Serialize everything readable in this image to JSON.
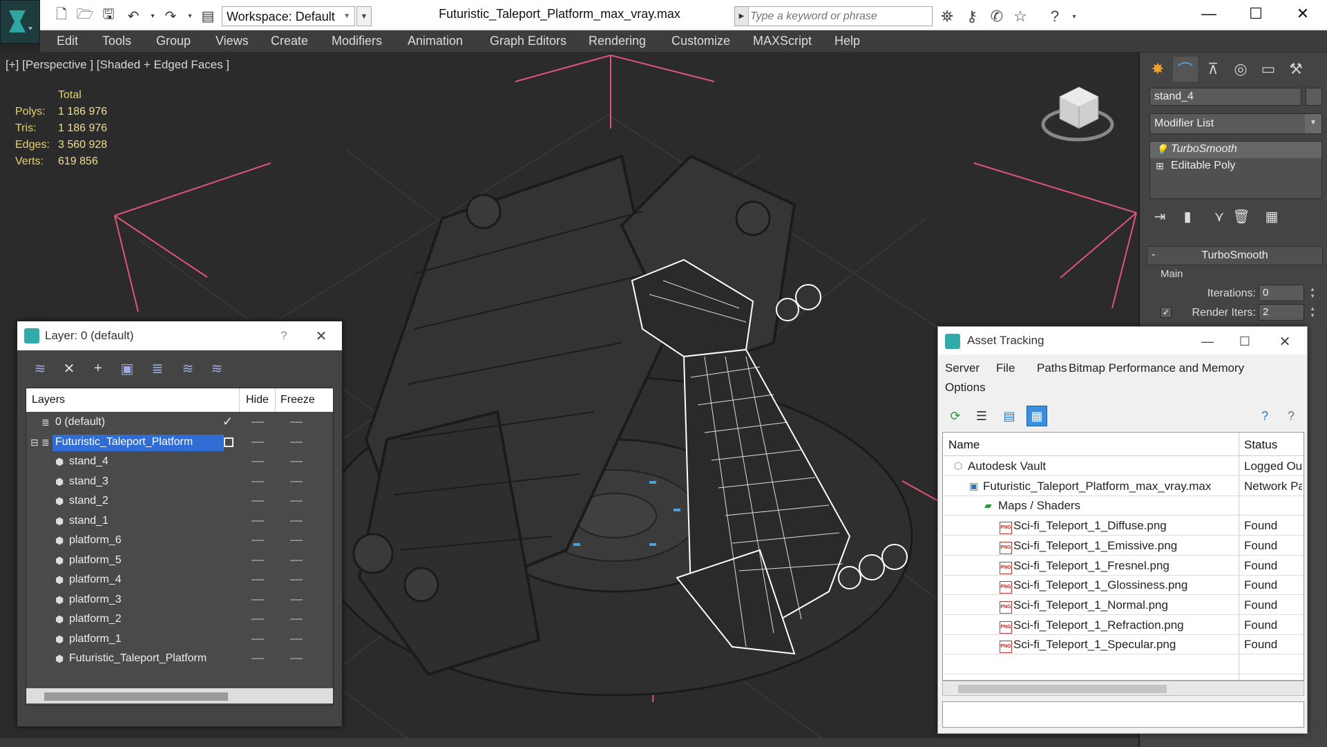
{
  "titlebar": {
    "workspace": "Workspace: Default",
    "document_title": "Futuristic_Taleport_Platform_max_vray.max",
    "search_placeholder": "Type a keyword or phrase"
  },
  "menubar": {
    "items": [
      "Edit",
      "Tools",
      "Group",
      "Views",
      "Create",
      "Modifiers",
      "Animation",
      "Graph Editors",
      "Rendering",
      "Customize",
      "MAXScript",
      "Help"
    ]
  },
  "viewport": {
    "label": "[+] [Perspective ] [Shaded + Edged Faces ]",
    "stats": {
      "header": "Total",
      "polys_label": "Polys:",
      "polys": "1 186 976",
      "tris_label": "Tris:",
      "tris": "1 186 976",
      "edges_label": "Edges:",
      "edges": "3 560 928",
      "verts_label": "Verts:",
      "verts": "619 856"
    }
  },
  "command_panel": {
    "object_name": "stand_4",
    "modifier_list": "Modifier List",
    "stack": [
      "TurboSmooth",
      "Editable Poly"
    ],
    "rollout_title": "TurboSmooth",
    "group_main": "Main",
    "iterations_label": "Iterations:",
    "iterations": "0",
    "render_iters_label": "Render Iters:",
    "render_iters": "2"
  },
  "layer_dialog": {
    "title": "Layer: 0 (default)",
    "help": "?",
    "columns": {
      "layers": "Layers",
      "hide": "Hide",
      "freeze": "Freeze"
    },
    "rows": [
      {
        "name": "0 (default)",
        "level": 0,
        "type": "layer",
        "current": true
      },
      {
        "name": "Futuristic_Taleport_Platform",
        "level": 0,
        "type": "layer",
        "selected": true
      },
      {
        "name": "stand_4",
        "level": 1,
        "type": "object"
      },
      {
        "name": "stand_3",
        "level": 1,
        "type": "object"
      },
      {
        "name": "stand_2",
        "level": 1,
        "type": "object"
      },
      {
        "name": "stand_1",
        "level": 1,
        "type": "object"
      },
      {
        "name": "platform_6",
        "level": 1,
        "type": "object"
      },
      {
        "name": "platform_5",
        "level": 1,
        "type": "object"
      },
      {
        "name": "platform_4",
        "level": 1,
        "type": "object"
      },
      {
        "name": "platform_3",
        "level": 1,
        "type": "object"
      },
      {
        "name": "platform_2",
        "level": 1,
        "type": "object"
      },
      {
        "name": "platform_1",
        "level": 1,
        "type": "object"
      },
      {
        "name": "Futuristic_Taleport_Platform",
        "level": 1,
        "type": "object"
      }
    ]
  },
  "asset_dialog": {
    "title": "Asset Tracking",
    "menus": [
      "Server",
      "File",
      "Paths",
      "Bitmap Performance and Memory",
      "Options"
    ],
    "columns": {
      "name": "Name",
      "status": "Status"
    },
    "rows": [
      {
        "name": "Autodesk Vault",
        "status": "Logged Ou",
        "level": 0,
        "icon": "vault"
      },
      {
        "name": "Futuristic_Taleport_Platform_max_vray.max",
        "status": "Network Pa",
        "level": 1,
        "icon": "max"
      },
      {
        "name": "Maps / Shaders",
        "status": "",
        "level": 2,
        "icon": "maps"
      },
      {
        "name": "Sci-fi_Teleport_1_Diffuse.png",
        "status": "Found",
        "level": 3,
        "icon": "png"
      },
      {
        "name": "Sci-fi_Teleport_1_Emissive.png",
        "status": "Found",
        "level": 3,
        "icon": "png"
      },
      {
        "name": "Sci-fi_Teleport_1_Fresnel.png",
        "status": "Found",
        "level": 3,
        "icon": "png"
      },
      {
        "name": "Sci-fi_Teleport_1_Glossiness.png",
        "status": "Found",
        "level": 3,
        "icon": "png"
      },
      {
        "name": "Sci-fi_Teleport_1_Normal.png",
        "status": "Found",
        "level": 3,
        "icon": "png"
      },
      {
        "name": "Sci-fi_Teleport_1_Refraction.png",
        "status": "Found",
        "level": 3,
        "icon": "png"
      },
      {
        "name": "Sci-fi_Teleport_1_Specular.png",
        "status": "Found",
        "level": 3,
        "icon": "png"
      }
    ]
  },
  "colors": {
    "accent": "#2f6cd3",
    "stats_text": "#e6d46a",
    "grid_bounds": "#e0557a",
    "viewport_bg": "#2b2b2b"
  }
}
